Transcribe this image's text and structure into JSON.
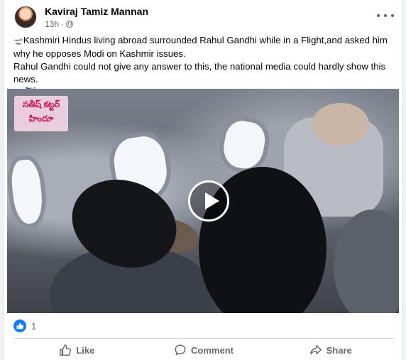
{
  "post": {
    "author": "Kaviraj Tamiz Mannan",
    "time": "13h",
    "separator": "·",
    "text_line_1": "Kashmiri Hindus living abroad surrounded Rahul Gandhi while in a Flight,and asked him why he opposes Modi on Kashmir issues.",
    "text_line_2": "Rahul Gandhi could not give any answer to this, the national media could hardly show this news.",
    "text_line_3": "👞✈️",
    "leading_emoji": "🛫"
  },
  "video": {
    "watermark_line_1": "సతీష్ కట్టర్",
    "watermark_line_2": "హిందూ"
  },
  "reactions": {
    "count": "1"
  },
  "actions": {
    "like_label": "Like",
    "comment_label": "Comment",
    "share_label": "Share"
  },
  "icons": {
    "privacy": "globe-icon",
    "more": "more-options-icon",
    "like": "thumbs-up-icon",
    "comment": "comment-bubble-icon",
    "share": "share-arrow-icon",
    "play": "play-icon"
  },
  "colors": {
    "accent": "#1877f2",
    "secondary_text": "#65676b",
    "primary_text": "#050505"
  }
}
